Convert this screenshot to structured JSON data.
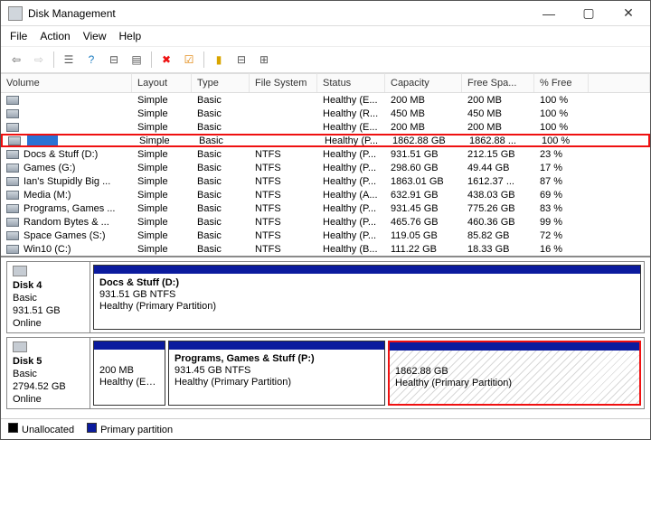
{
  "window": {
    "title": "Disk Management"
  },
  "menu": {
    "file": "File",
    "action": "Action",
    "view": "View",
    "help": "Help"
  },
  "columns": {
    "volume": "Volume",
    "layout": "Layout",
    "type": "Type",
    "fs": "File System",
    "status": "Status",
    "capacity": "Capacity",
    "free": "Free Spa...",
    "pctfree": "% Free"
  },
  "rows": [
    {
      "name": "",
      "layout": "Simple",
      "type": "Basic",
      "fs": "",
      "status": "Healthy (E...",
      "capacity": "200 MB",
      "free": "200 MB",
      "pct": "100 %",
      "selected": false
    },
    {
      "name": "",
      "layout": "Simple",
      "type": "Basic",
      "fs": "",
      "status": "Healthy (R...",
      "capacity": "450 MB",
      "free": "450 MB",
      "pct": "100 %",
      "selected": false
    },
    {
      "name": "",
      "layout": "Simple",
      "type": "Basic",
      "fs": "",
      "status": "Healthy (E...",
      "capacity": "200 MB",
      "free": "200 MB",
      "pct": "100 %",
      "selected": false
    },
    {
      "name": "",
      "layout": "Simple",
      "type": "Basic",
      "fs": "",
      "status": "Healthy (P...",
      "capacity": "1862.88 GB",
      "free": "1862.88 ...",
      "pct": "100 %",
      "selected": true,
      "highlight": true
    },
    {
      "name": "Docs & Stuff (D:)",
      "layout": "Simple",
      "type": "Basic",
      "fs": "NTFS",
      "status": "Healthy (P...",
      "capacity": "931.51 GB",
      "free": "212.15 GB",
      "pct": "23 %"
    },
    {
      "name": "Games (G:)",
      "layout": "Simple",
      "type": "Basic",
      "fs": "NTFS",
      "status": "Healthy (P...",
      "capacity": "298.60 GB",
      "free": "49.44 GB",
      "pct": "17 %"
    },
    {
      "name": "Ian's Stupidly Big ...",
      "layout": "Simple",
      "type": "Basic",
      "fs": "NTFS",
      "status": "Healthy (P...",
      "capacity": "1863.01 GB",
      "free": "1612.37 ...",
      "pct": "87 %"
    },
    {
      "name": "Media (M:)",
      "layout": "Simple",
      "type": "Basic",
      "fs": "NTFS",
      "status": "Healthy (A...",
      "capacity": "632.91 GB",
      "free": "438.03 GB",
      "pct": "69 %"
    },
    {
      "name": "Programs, Games ...",
      "layout": "Simple",
      "type": "Basic",
      "fs": "NTFS",
      "status": "Healthy (P...",
      "capacity": "931.45 GB",
      "free": "775.26 GB",
      "pct": "83 %"
    },
    {
      "name": "Random Bytes & ...",
      "layout": "Simple",
      "type": "Basic",
      "fs": "NTFS",
      "status": "Healthy (P...",
      "capacity": "465.76 GB",
      "free": "460.36 GB",
      "pct": "99 %"
    },
    {
      "name": "Space Games (S:)",
      "layout": "Simple",
      "type": "Basic",
      "fs": "NTFS",
      "status": "Healthy (P...",
      "capacity": "119.05 GB",
      "free": "85.82 GB",
      "pct": "72 %"
    },
    {
      "name": "Win10 (C:)",
      "layout": "Simple",
      "type": "Basic",
      "fs": "NTFS",
      "status": "Healthy (B...",
      "capacity": "111.22 GB",
      "free": "18.33 GB",
      "pct": "16 %"
    }
  ],
  "disks": {
    "d4": {
      "label": "Disk 4",
      "kind": "Basic",
      "size": "931.51 GB",
      "state": "Online",
      "p0": {
        "title": "Docs & Stuff  (D:)",
        "sub1": "931.51 GB NTFS",
        "sub2": "Healthy (Primary Partition)"
      }
    },
    "d5": {
      "label": "Disk 5",
      "kind": "Basic",
      "size": "2794.52 GB",
      "state": "Online",
      "p0": {
        "sub1": "200 MB",
        "sub2": "Healthy (EFI Sys"
      },
      "p1": {
        "title": "Programs, Games & Stuff  (P:)",
        "sub1": "931.45 GB NTFS",
        "sub2": "Healthy (Primary Partition)"
      },
      "p2": {
        "sub1": "1862.88 GB",
        "sub2": "Healthy (Primary Partition)"
      }
    }
  },
  "legend": {
    "unalloc": "Unallocated",
    "primary": "Primary partition"
  }
}
